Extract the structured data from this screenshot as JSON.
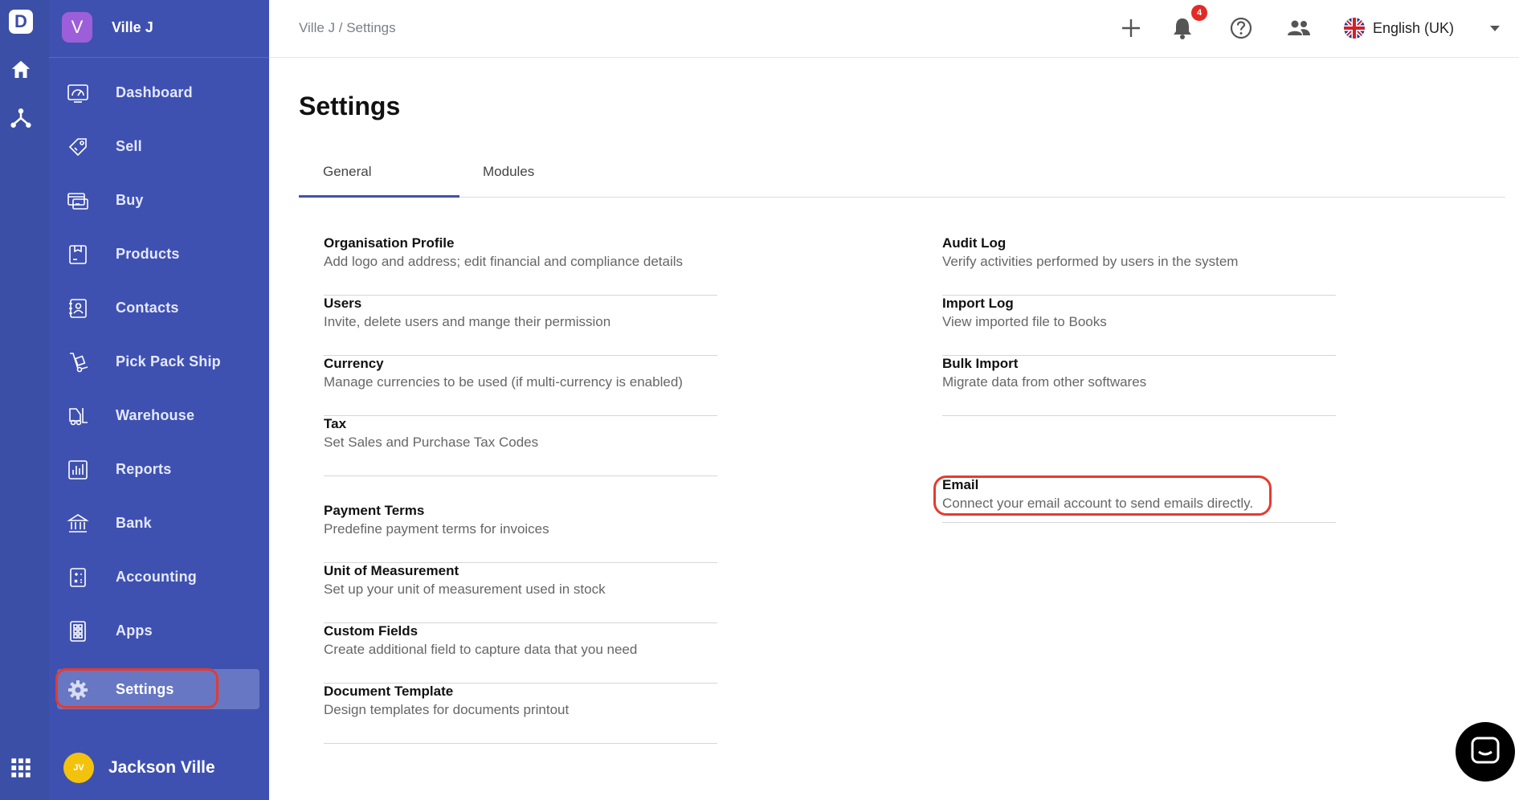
{
  "colors": {
    "sidebar_bg": "#3f51b0",
    "rail_bg": "#3c4fa6",
    "active_item_bg": "#6877c3",
    "highlight": "#e53b2f",
    "notification_badge": "#e32a24"
  },
  "rail": {
    "logo_letter": "D",
    "icons": [
      "home-icon",
      "hierarchy-icon",
      "apps-grid-icon"
    ]
  },
  "sidebar": {
    "org": {
      "initial": "V",
      "name": "Ville J"
    },
    "items": [
      {
        "label": "Dashboard",
        "icon": "dashboard-gauge-icon"
      },
      {
        "label": "Sell",
        "icon": "price-tag-icon"
      },
      {
        "label": "Buy",
        "icon": "cart-card-icon"
      },
      {
        "label": "Products",
        "icon": "box-icon"
      },
      {
        "label": "Contacts",
        "icon": "contact-book-icon"
      },
      {
        "label": "Pick Pack Ship",
        "icon": "hand-truck-icon"
      },
      {
        "label": "Warehouse",
        "icon": "forklift-icon"
      },
      {
        "label": "Reports",
        "icon": "bar-report-icon"
      },
      {
        "label": "Bank",
        "icon": "bank-icon"
      },
      {
        "label": "Accounting",
        "icon": "calculator-doc-icon"
      },
      {
        "label": "Apps",
        "icon": "apps-icon"
      },
      {
        "label": "Settings",
        "icon": "gear-icon",
        "active": true
      }
    ],
    "user": {
      "initials": "JV",
      "name": "Jackson Ville"
    }
  },
  "header": {
    "breadcrumb": "Ville J / Settings",
    "notification_count": "4",
    "language": "English (UK)",
    "icons": [
      "plus-icon",
      "bell-icon",
      "help-icon",
      "users-icon",
      "uk-flag-icon",
      "chevron-down-icon"
    ]
  },
  "main": {
    "title": "Settings",
    "tabs": [
      {
        "label": "General",
        "active": true
      },
      {
        "label": "Modules",
        "active": false
      }
    ],
    "left_items": [
      {
        "title": "Organisation Profile",
        "desc": "Add logo and address; edit financial and compliance details"
      },
      {
        "title": "Users",
        "desc": "Invite, delete users and mange their permission"
      },
      {
        "title": "Currency",
        "desc": "Manage currencies to be used (if multi-currency is enabled)"
      },
      {
        "title": "Tax",
        "desc": "Set Sales and Purchase Tax Codes"
      },
      {
        "title": "Payment Terms",
        "desc": "Predefine payment terms for invoices"
      },
      {
        "title": "Unit of Measurement",
        "desc": "Set up your unit of measurement used in stock"
      },
      {
        "title": "Custom Fields",
        "desc": "Create additional field to capture data that you need"
      },
      {
        "title": "Document Template",
        "desc": "Design templates for documents printout"
      }
    ],
    "right_items": [
      {
        "title": "Audit Log",
        "desc": "Verify activities performed by users in the system"
      },
      {
        "title": "Import Log",
        "desc": "View imported file to Books"
      },
      {
        "title": "Bulk Import",
        "desc": "Migrate data from other softwares"
      },
      {
        "title": "Email",
        "desc": "Connect your email account to send emails directly."
      }
    ]
  },
  "chat_widget": {
    "icon": "chat-bubble-icon"
  }
}
